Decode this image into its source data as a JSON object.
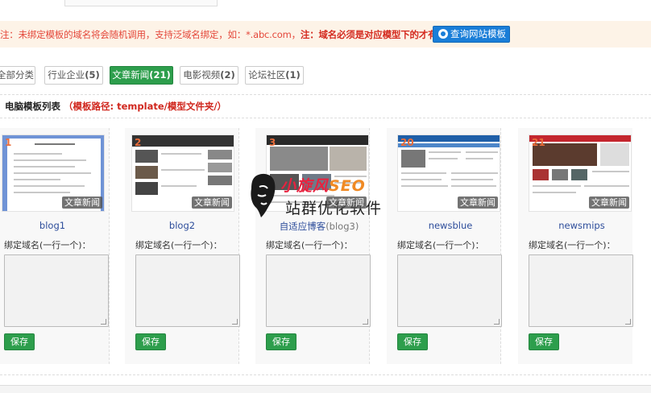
{
  "notice": {
    "prefix": "注：",
    "text": "未绑定模板的域名将会随机调用，支持泛域名绑定，如：*.abc.com，",
    "warn": "注：域名必须是对应模型下的才有效",
    "button_label": "查询网站模板"
  },
  "filters": [
    {
      "label": "全部分类",
      "count": ""
    },
    {
      "label": "行业企业",
      "count": "(5)"
    },
    {
      "label": "文章新闻",
      "count": "(21)"
    },
    {
      "label": "电影视频",
      "count": "(2)"
    },
    {
      "label": "论坛社区",
      "count": "(1)"
    }
  ],
  "section": {
    "title": "电脑模板列表",
    "path_open": "（",
    "path_label": "模板路径: template/模型文件夹/",
    "path_close": "）"
  },
  "cards": [
    {
      "num": "1",
      "category": "文章新闻",
      "name": "blog1",
      "sub": "",
      "bind_label": "绑定域名(一行一个)：",
      "save_label": "保存"
    },
    {
      "num": "2",
      "category": "文章新闻",
      "name": "blog2",
      "sub": "",
      "bind_label": "绑定域名(一行一个)：",
      "save_label": "保存"
    },
    {
      "num": "3",
      "category": "文章新闻",
      "name": "自适应博客",
      "sub": "(blog3)",
      "bind_label": "绑定域名(一行一个)：",
      "save_label": "保存"
    },
    {
      "num": "20",
      "category": "文章新闻",
      "name": "newsblue",
      "sub": "",
      "bind_label": "绑定域名(一行一个)：",
      "save_label": "保存"
    },
    {
      "num": "21",
      "category": "文章新闻",
      "name": "newsmips",
      "sub": "",
      "bind_label": "绑定域名(一行一个)：",
      "save_label": "保存"
    }
  ],
  "watermark": {
    "brand_a": "小旋风",
    "brand_b": "SEO",
    "slogan": "站群优化软件"
  },
  "colors": {
    "accent_green": "#2d9e4c",
    "accent_blue": "#1a7ed8",
    "warning_red": "#e4473a",
    "notice_bg": "#fdf3e7"
  }
}
